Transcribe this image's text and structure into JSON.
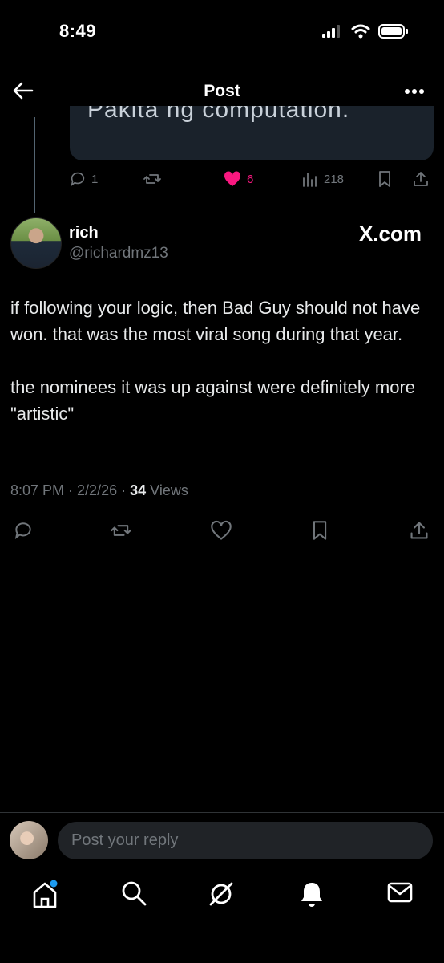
{
  "status": {
    "time": "8:49"
  },
  "header": {
    "title": "Post"
  },
  "quoted_post": {
    "text": "Pakita ng computation.",
    "replies": "1",
    "likes": "6",
    "views": "218"
  },
  "post": {
    "author_name": "rich",
    "author_handle": "@richardmz13",
    "source": "X.com",
    "paragraphs": [
      "if following your logic, then Bad Guy should not have won. that was the most viral song during that year.",
      "the nominees it was up against were definitely more \"artistic\""
    ],
    "time": "8:07 PM",
    "date": "2/2/26",
    "views_count": "34",
    "views_label": "Views"
  },
  "reply": {
    "placeholder": "Post your reply"
  },
  "colors": {
    "like": "#f91880",
    "notification_dot": "#1d9bf0",
    "muted": "#71767b"
  },
  "icons": [
    "back-arrow-icon",
    "more-icon",
    "reply-icon",
    "repost-icon",
    "heart-icon",
    "views-icon",
    "bookmark-icon",
    "share-icon",
    "home-icon",
    "search-icon",
    "grok-icon",
    "bell-icon",
    "mail-icon"
  ]
}
